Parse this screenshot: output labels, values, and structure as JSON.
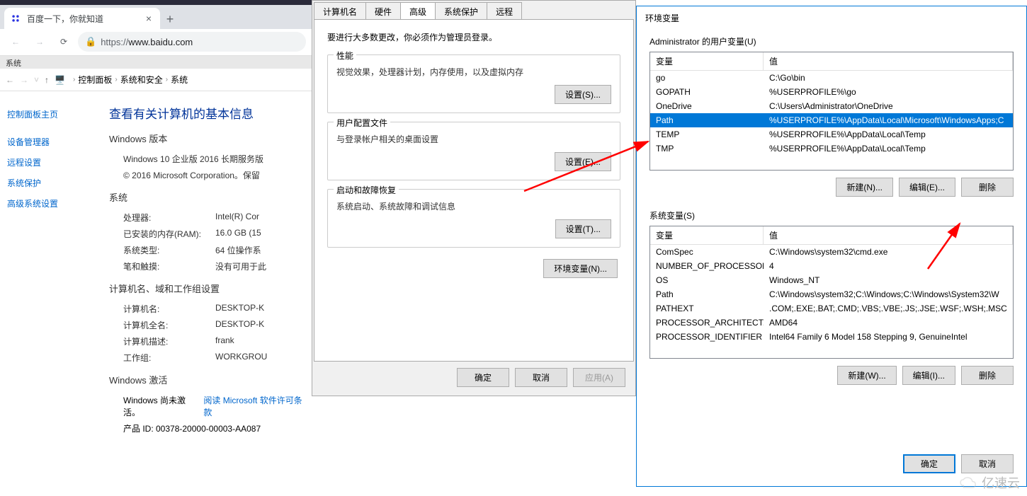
{
  "browser": {
    "tab_title": "百度一下，你就知道",
    "close": "×",
    "new_tab": "+",
    "url_display_scheme": "https://",
    "url_display_host": "www.baidu.com"
  },
  "control_panel": {
    "menu": "系统",
    "breadcrumb": [
      "控制面板",
      "系统和安全",
      "系统"
    ],
    "sidebar": [
      "控制面板主页",
      "设备管理器",
      "远程设置",
      "系统保护",
      "高级系统设置"
    ],
    "heading": "查看有关计算机的基本信息",
    "version_section": "Windows 版本",
    "version_name": "Windows 10 企业版 2016 长期服务版",
    "copyright": "© 2016 Microsoft Corporation。保留",
    "system_section": "系统",
    "rows": [
      {
        "label": "处理器:",
        "value": "Intel(R) Cor"
      },
      {
        "label": "已安装的内存(RAM):",
        "value": "16.0 GB (15"
      },
      {
        "label": "系统类型:",
        "value": "64 位操作系"
      },
      {
        "label": "笔和触摸:",
        "value": "没有可用于此"
      }
    ],
    "computer_section": "计算机名、域和工作组设置",
    "computer_rows": [
      {
        "label": "计算机名:",
        "value": "DESKTOP-K"
      },
      {
        "label": "计算机全名:",
        "value": "DESKTOP-K"
      },
      {
        "label": "计算机描述:",
        "value": "frank"
      },
      {
        "label": "工作组:",
        "value": "WORKGROU"
      }
    ],
    "activation_section": "Windows 激活",
    "activation_status": "Windows 尚未激活。",
    "activation_link": "阅读 Microsoft 软件许可条款",
    "product_id": "产品 ID: 00378-20000-00003-AA087"
  },
  "sys_props": {
    "tabs": [
      "计算机名",
      "硬件",
      "高级",
      "系统保护",
      "远程"
    ],
    "active_tab_index": 2,
    "admin_note": "要进行大多数更改，你必须作为管理员登录。",
    "groups": [
      {
        "title": "性能",
        "desc": "视觉效果，处理器计划，内存使用，以及虚拟内存",
        "btn": "设置(S)..."
      },
      {
        "title": "用户配置文件",
        "desc": "与登录帐户相关的桌面设置",
        "btn": "设置(E)..."
      },
      {
        "title": "启动和故障恢复",
        "desc": "系统启动、系统故障和调试信息",
        "btn": "设置(T)..."
      }
    ],
    "env_btn": "环境变量(N)...",
    "ok": "确定",
    "cancel": "取消",
    "apply": "应用(A)"
  },
  "env": {
    "title": "环境变量",
    "user_label": "Administrator 的用户变量(U)",
    "col_var": "变量",
    "col_val": "值",
    "user_vars": [
      {
        "name": "go",
        "value": "C:\\Go\\bin"
      },
      {
        "name": "GOPATH",
        "value": "%USERPROFILE%\\go"
      },
      {
        "name": "OneDrive",
        "value": "C:\\Users\\Administrator\\OneDrive"
      },
      {
        "name": "Path",
        "value": "%USERPROFILE%\\AppData\\Local\\Microsoft\\WindowsApps;C",
        "selected": true
      },
      {
        "name": "TEMP",
        "value": "%USERPROFILE%\\AppData\\Local\\Temp"
      },
      {
        "name": "TMP",
        "value": "%USERPROFILE%\\AppData\\Local\\Temp"
      }
    ],
    "sys_label": "系统变量(S)",
    "sys_vars": [
      {
        "name": "ComSpec",
        "value": "C:\\Windows\\system32\\cmd.exe"
      },
      {
        "name": "NUMBER_OF_PROCESSORS",
        "value": "4"
      },
      {
        "name": "OS",
        "value": "Windows_NT"
      },
      {
        "name": "Path",
        "value": "C:\\Windows\\system32;C:\\Windows;C:\\Windows\\System32\\W"
      },
      {
        "name": "PATHEXT",
        "value": ".COM;.EXE;.BAT;.CMD;.VBS;.VBE;.JS;.JSE;.WSF;.WSH;.MSC"
      },
      {
        "name": "PROCESSOR_ARCHITECT...",
        "value": "AMD64"
      },
      {
        "name": "PROCESSOR_IDENTIFIER",
        "value": "Intel64 Family 6 Model 158 Stepping 9, GenuineIntel"
      }
    ],
    "btn_new_u": "新建(N)...",
    "btn_edit_u": "编辑(E)...",
    "btn_del_u": "删除",
    "btn_new_s": "新建(W)...",
    "btn_edit_s": "编辑(I)...",
    "btn_del_s": "删除",
    "ok": "确定",
    "cancel": "取消"
  },
  "watermark": "亿速云"
}
